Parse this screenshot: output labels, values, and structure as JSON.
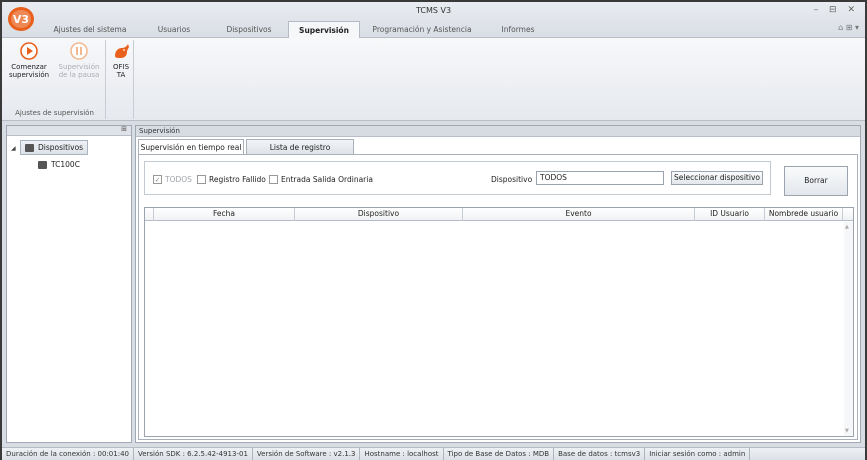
{
  "window": {
    "title": "TCMS V3",
    "logo_text": "V3",
    "controls": "– ⊟ ✕",
    "help_icons": "⌂ ⊞ ▾"
  },
  "tabs": [
    {
      "label": "Ajustes del sistema"
    },
    {
      "label": "Usuarios"
    },
    {
      "label": "Dispositivos"
    },
    {
      "label": "Supervisión"
    },
    {
      "label": "Programación y Asistencia"
    },
    {
      "label": "Informes"
    }
  ],
  "ribbon": {
    "start_label": "Comenzar supervisión",
    "pause_label": "Supervisión de la pausa",
    "group_label": "Ajustes de supervisión",
    "ofista_label": "OFIS TA"
  },
  "tree": {
    "pin": "⊞",
    "root_label": "Dispositivos",
    "child_label": "TC100C"
  },
  "main": {
    "panel_title": "Supervisión",
    "subtabs": [
      {
        "label": "Supervisión en tiempo real"
      },
      {
        "label": "Lista de registro"
      }
    ],
    "filters": {
      "todos_label": "TODOS",
      "todos_checked": true,
      "registro_fallido_label": "Registro Fallido",
      "entrada_salida_label": "Entrada Salida Ordinaria",
      "dispositivo_label": "Dispositivo",
      "dispositivo_value": "TODOS",
      "select_device_button": "Seleccionar dispositivo",
      "clear_button": "Borrar"
    },
    "grid_columns": [
      {
        "label": "Fecha"
      },
      {
        "label": "Dispositivo"
      },
      {
        "label": "Evento"
      },
      {
        "label": "ID Usuario"
      },
      {
        "label": "Nombrede usuario"
      }
    ]
  },
  "status_bar": [
    {
      "text": "Duración de la conexión : 00:01:40"
    },
    {
      "text": "Versión SDK : 6.2.5.42-4913-01"
    },
    {
      "text": "Versión de Software : v2.1.3"
    },
    {
      "text": "Hostname : localhost"
    },
    {
      "text": "Tipo de Base de Datos : MDB"
    },
    {
      "text": "Base de datos : tcmsv3"
    },
    {
      "text": "Iniciar sesión como : admin"
    }
  ],
  "colors": {
    "accent_orange": "#e8601c",
    "play_orange": "#e8601c",
    "pause_disabled": "#f2b98f"
  }
}
